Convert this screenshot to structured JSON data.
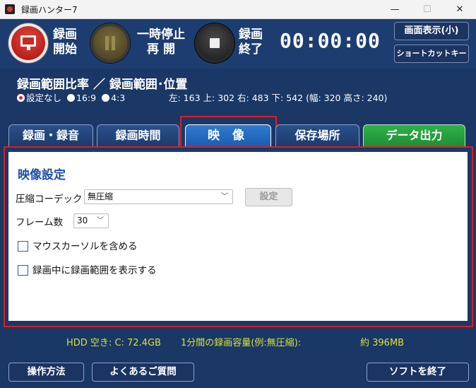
{
  "window": {
    "title": "録画ハンター7",
    "min_icon": "—",
    "max_icon": "☐",
    "close_icon": "✕"
  },
  "controls": {
    "record_label_1": "録画",
    "record_label_2": "開始",
    "pause_label_1": "一時停止",
    "pause_label_2": "再 開",
    "stop_label_1": "録画",
    "stop_label_2": "終了",
    "timer": "00:00:00",
    "display_button": "画面表示(小)",
    "shortcut_button": "ショートカットキー"
  },
  "range": {
    "title": "録画範囲比率 ／ 録画範囲･位置",
    "options": [
      "設定なし",
      "16:9",
      "4:3"
    ],
    "selected": "設定なし",
    "coords_text": "左: 163 上: 302 右: 483  下: 542 (幅: 320 高さ: 240)"
  },
  "tabs": [
    "録画・録音",
    "録画時間",
    "映 像",
    "保存場所",
    "データ出力"
  ],
  "active_tab": "映 像",
  "video_settings": {
    "heading": "映像設定",
    "codec_label": "圧縮コーデック",
    "codec_value": "無圧縮",
    "settings_button": "設定",
    "fps_label": "フレーム数",
    "fps_value": "30",
    "include_cursor_label": "マウスカーソルを含める",
    "show_range_label": "録画中に録画範囲を表示する"
  },
  "status": {
    "hdd_free": "HDD 空き: C: 72.4GB",
    "per_minute_label": "1分間の録画容量(例:無圧縮):",
    "per_minute_value": "約 396MB"
  },
  "footer": {
    "howto_button": "操作方法",
    "faq_button": "よくあるご質問",
    "exit_button": "ソフトを終了"
  },
  "colors": {
    "background": "#1a3766",
    "accent_red": "#d81f26",
    "status_yellow": "#d6e23c",
    "data_tab_green": "#2fb04a",
    "heading_blue": "#1f4fa3"
  }
}
